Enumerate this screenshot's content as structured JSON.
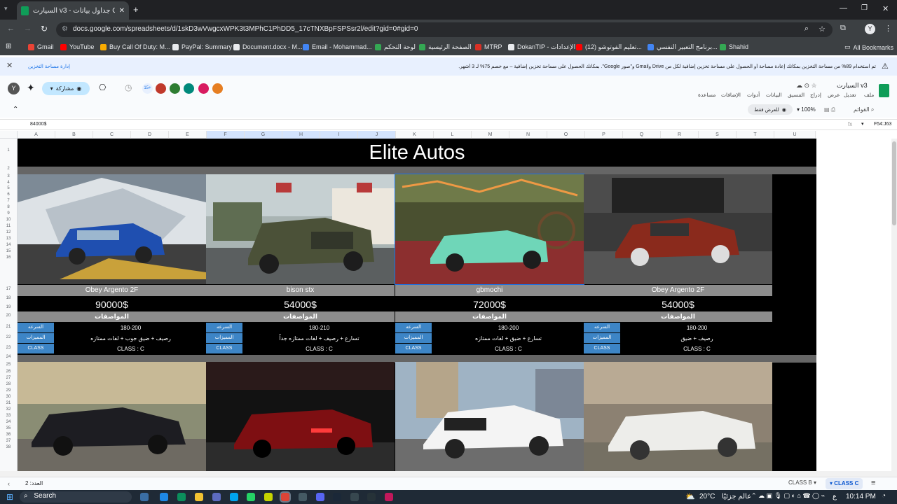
{
  "browser": {
    "tab_title": "السيارت v3 - جداول بيانات Google",
    "url": "docs.google.com/spreadsheets/d/1skD3wVwgcxWPK3t3MPhC1PhDD5_17cTNXBpFSPSsr2l/edit?gid=0#gid=0",
    "profile_initial": "Y"
  },
  "bookmarks": [
    {
      "label": "Gmail",
      "color": "#ea4335"
    },
    {
      "label": "YouTube",
      "color": "#ff0000"
    },
    {
      "label": "Buy Call Of Duty: M...",
      "color": "#f9ab00"
    },
    {
      "label": "PayPal: Summary",
      "color": "#e8eaed"
    },
    {
      "label": "Document.docx - M...",
      "color": "#e8eaed"
    },
    {
      "label": "Email - Mohammad...",
      "color": "#4285f4"
    },
    {
      "label": "لوحة التحكم",
      "color": "#34a853"
    },
    {
      "label": "الصفحة الرئيسية",
      "color": "#34a853"
    },
    {
      "label": "MTRP",
      "color": "#d93025"
    },
    {
      "label": "DokanTIP - الإعدادات",
      "color": "#e8eaed"
    },
    {
      "label": "(12) تعليم الفوتوشو...",
      "color": "#ff0000"
    },
    {
      "label": "برنامج التعبير النفسي...",
      "color": "#4285f4"
    },
    {
      "label": "Shahid",
      "color": "#34a853"
    }
  ],
  "all_bookmarks": "All Bookmarks",
  "banner": {
    "message": "تم استخدام 89% من مساحة التخزين بمكانك إعادة مساحة أو الحصول على مساحة تخزين إضافية لكل من Drive وGmail و\"صور Google\". بمكانك الحصول على مساحة تخزين إضافية – مع خصم 75% لـ 3 أشهر.",
    "manage": "إدارة مساحة التخزين"
  },
  "docs": {
    "file_title": "السيارت v3",
    "menus": [
      "ملف",
      "تعديل",
      "عرض",
      "إدراج",
      "التنسيق",
      "البيانات",
      "أدوات",
      "الإضافات",
      "مساعدة"
    ],
    "share": "مشاركة",
    "avatar": "Y",
    "extra_count": "15+",
    "menus_search": "القوائم",
    "zoom": "100%",
    "view_only": "للعرض فقط"
  },
  "formula_bar": {
    "cell_ref": "F54:J63",
    "value": "84000$"
  },
  "columns": [
    "A",
    "B",
    "C",
    "D",
    "E",
    "F",
    "G",
    "H",
    "I",
    "J",
    "K",
    "L",
    "M",
    "N",
    "O",
    "P",
    "Q",
    "R",
    "S",
    "T",
    "U"
  ],
  "rows": [
    "1",
    "2",
    "3",
    "4",
    "5",
    "6",
    "7",
    "8",
    "9",
    "10",
    "11",
    "12",
    "13",
    "14",
    "15",
    "16",
    "17",
    "18",
    "19",
    "20",
    "21",
    "22",
    "23",
    "24",
    "25",
    "26",
    "27",
    "28",
    "29",
    "30",
    "31",
    "32",
    "33",
    "34",
    "35",
    "36",
    "37",
    "38"
  ],
  "sheet": {
    "title": "Elite Autos",
    "spec_header": "المواصفات",
    "labels": {
      "speed": "السرعه",
      "features": "المميزات",
      "class": "CLASS"
    },
    "cars": [
      {
        "name": "Obey Argento 2F",
        "price": "90000$",
        "speed": "180-200",
        "features": "رصيف + ضيق جوب + لفات ممتازه",
        "class": "CLASS : C"
      },
      {
        "name": "bison stx",
        "price": "54000$",
        "speed": "180-210",
        "features": "تسارع + رصيف + لفات ممتازه جداً",
        "class": "CLASS : C"
      },
      {
        "name": "gbmochi",
        "price": "72000$",
        "speed": "180-200",
        "features": "تسارع + ضيق + لفات ممتازه",
        "class": "CLASS : C"
      },
      {
        "name": "Obey Argento 2F",
        "price": "54000$",
        "speed": "180-200",
        "features": "رصيف + ضيق",
        "class": "CLASS : C"
      }
    ]
  },
  "sheet_tabs": {
    "count": "العدد: 2",
    "tabs": [
      "CLASS B",
      "CLASS C"
    ],
    "active": "CLASS C"
  },
  "taskbar": {
    "search": "Search",
    "weather": "20°C",
    "weather_text": "عالم جزئيًا",
    "time": "10:14 PM",
    "lang": "ع"
  }
}
